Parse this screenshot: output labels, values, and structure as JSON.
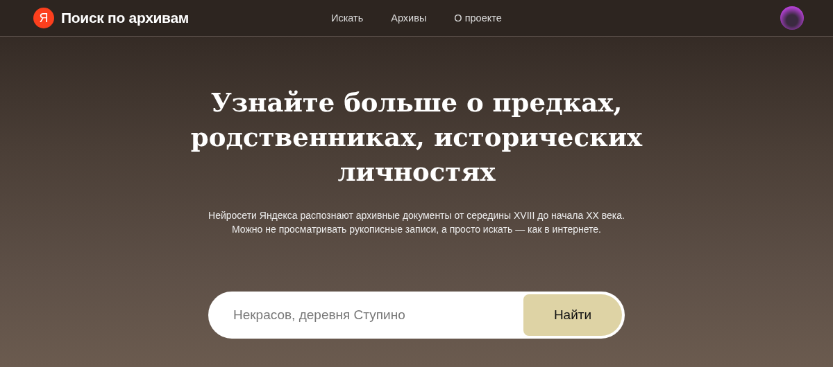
{
  "header": {
    "logo_letter": "Я",
    "title": "Поиск по архивам",
    "nav": [
      {
        "label": "Искать",
        "selected": false
      },
      {
        "label": "Архивы",
        "selected": false
      },
      {
        "label": "О проекте",
        "selected": false
      }
    ]
  },
  "hero": {
    "title": "Узнайте больше о предках, родственниках, исторических личностях",
    "subtitle": [
      "Нейросети Яндекса распознают архивные документы от середины XVIII до начала XX века.",
      "Можно не просматривать рукописные записи, а просто искать — как в интернете."
    ]
  },
  "search": {
    "placeholder": "Некрасов, деревня Ступино",
    "button": "Найти"
  }
}
